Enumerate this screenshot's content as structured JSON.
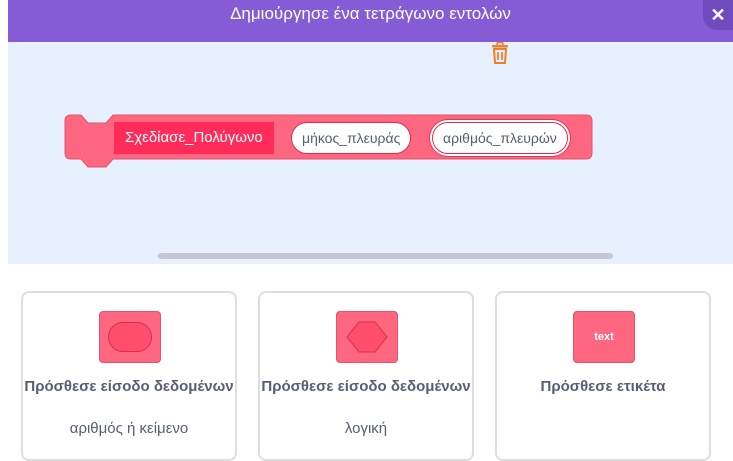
{
  "header": {
    "title": "Δημιούργησε ένα τετράγωνο εντολών",
    "close_icon": "close-icon"
  },
  "block": {
    "name": "Σχεδίασε_Πολύγωνο",
    "inputs": [
      "μήκος_πλευράς",
      "αριθμός_πλευρών"
    ],
    "color": "#ff6680"
  },
  "workspace": {
    "delete_icon": "trash-icon"
  },
  "options": [
    {
      "label": "Πρόσθεσε είσοδο δεδομένων",
      "sub": "αριθμός ή κείμενο",
      "icon": "oval-input-icon"
    },
    {
      "label": "Πρόσθεσε είσοδο δεδομένων",
      "sub": "λογική",
      "icon": "boolean-input-icon"
    },
    {
      "label": "Πρόσθεσε ετικέτα",
      "sub": "",
      "icon_text": "text",
      "icon": "label-icon"
    }
  ],
  "colors": {
    "header": "#855cd6",
    "workspace": "#e6f0ff",
    "block": "#ff6680",
    "block_dark": "#ff2c5a"
  }
}
